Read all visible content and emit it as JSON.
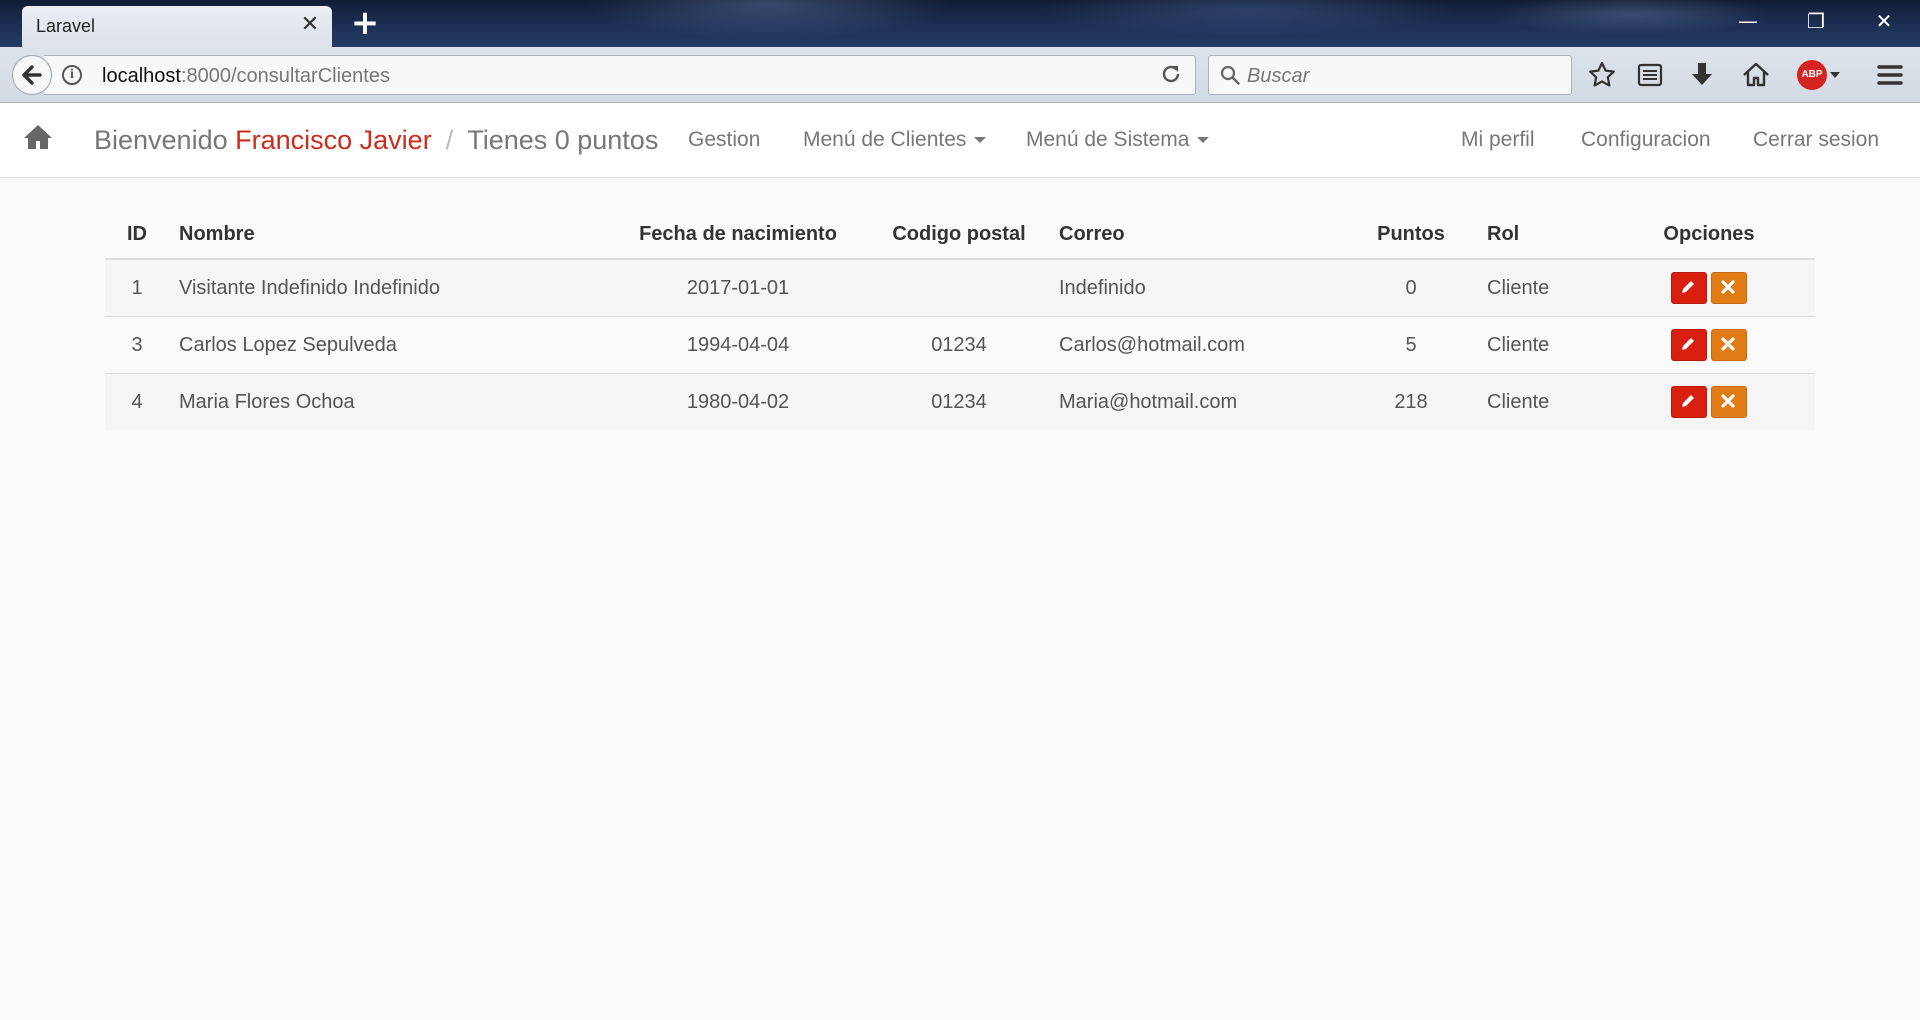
{
  "browser": {
    "tab_title": "Laravel",
    "tab_close": "✕",
    "new_tab": "+",
    "url_host": "localhost",
    "url_rest": ":8000/consultarClientes",
    "search_placeholder": "Buscar",
    "abp_label": "ABP",
    "window_controls": {
      "minimize": "—",
      "maximize": "❐",
      "close": "✕"
    }
  },
  "navbar": {
    "welcome": "Bienvenido",
    "user_name": "Francisco Javier",
    "separator": "/",
    "points_text": "Tienes 0 puntos",
    "links": {
      "gestion": "Gestion",
      "clientes": "Menú de Clientes",
      "sistema": "Menú de Sistema",
      "perfil": "Mi perfil",
      "config": "Configuracion",
      "logout": "Cerrar sesion"
    }
  },
  "table": {
    "headers": {
      "id": "ID",
      "nombre": "Nombre",
      "fecha": "Fecha de nacimiento",
      "cp": "Codigo postal",
      "correo": "Correo",
      "puntos": "Puntos",
      "rol": "Rol",
      "opciones": "Opciones"
    },
    "rows": [
      {
        "id": "1",
        "nombre": "Visitante Indefinido Indefinido",
        "fecha": "2017-01-01",
        "cp": "",
        "correo": "Indefinido",
        "puntos": "0",
        "rol": "Cliente"
      },
      {
        "id": "3",
        "nombre": "Carlos Lopez Sepulveda",
        "fecha": "1994-04-04",
        "cp": "01234",
        "correo": "Carlos@hotmail.com",
        "puntos": "5",
        "rol": "Cliente"
      },
      {
        "id": "4",
        "nombre": "Maria Flores Ochoa",
        "fecha": "1980-04-02",
        "cp": "01234",
        "correo": "Maria@hotmail.com",
        "puntos": "218",
        "rol": "Cliente"
      }
    ]
  },
  "colors": {
    "accent_user": "#cc2c1e",
    "edit_button": "#d9200e",
    "delete_button": "#e17b16"
  },
  "icons": {
    "home": "home-icon",
    "edit": "pencil-icon",
    "delete": "close-icon",
    "back": "arrow-left-icon",
    "reload": "reload-icon",
    "search": "search-icon",
    "bookmark": "star-icon",
    "reader": "reading-list-icon",
    "download": "download-icon",
    "browser_home": "home-icon",
    "menu": "hamburger-menu-icon"
  }
}
